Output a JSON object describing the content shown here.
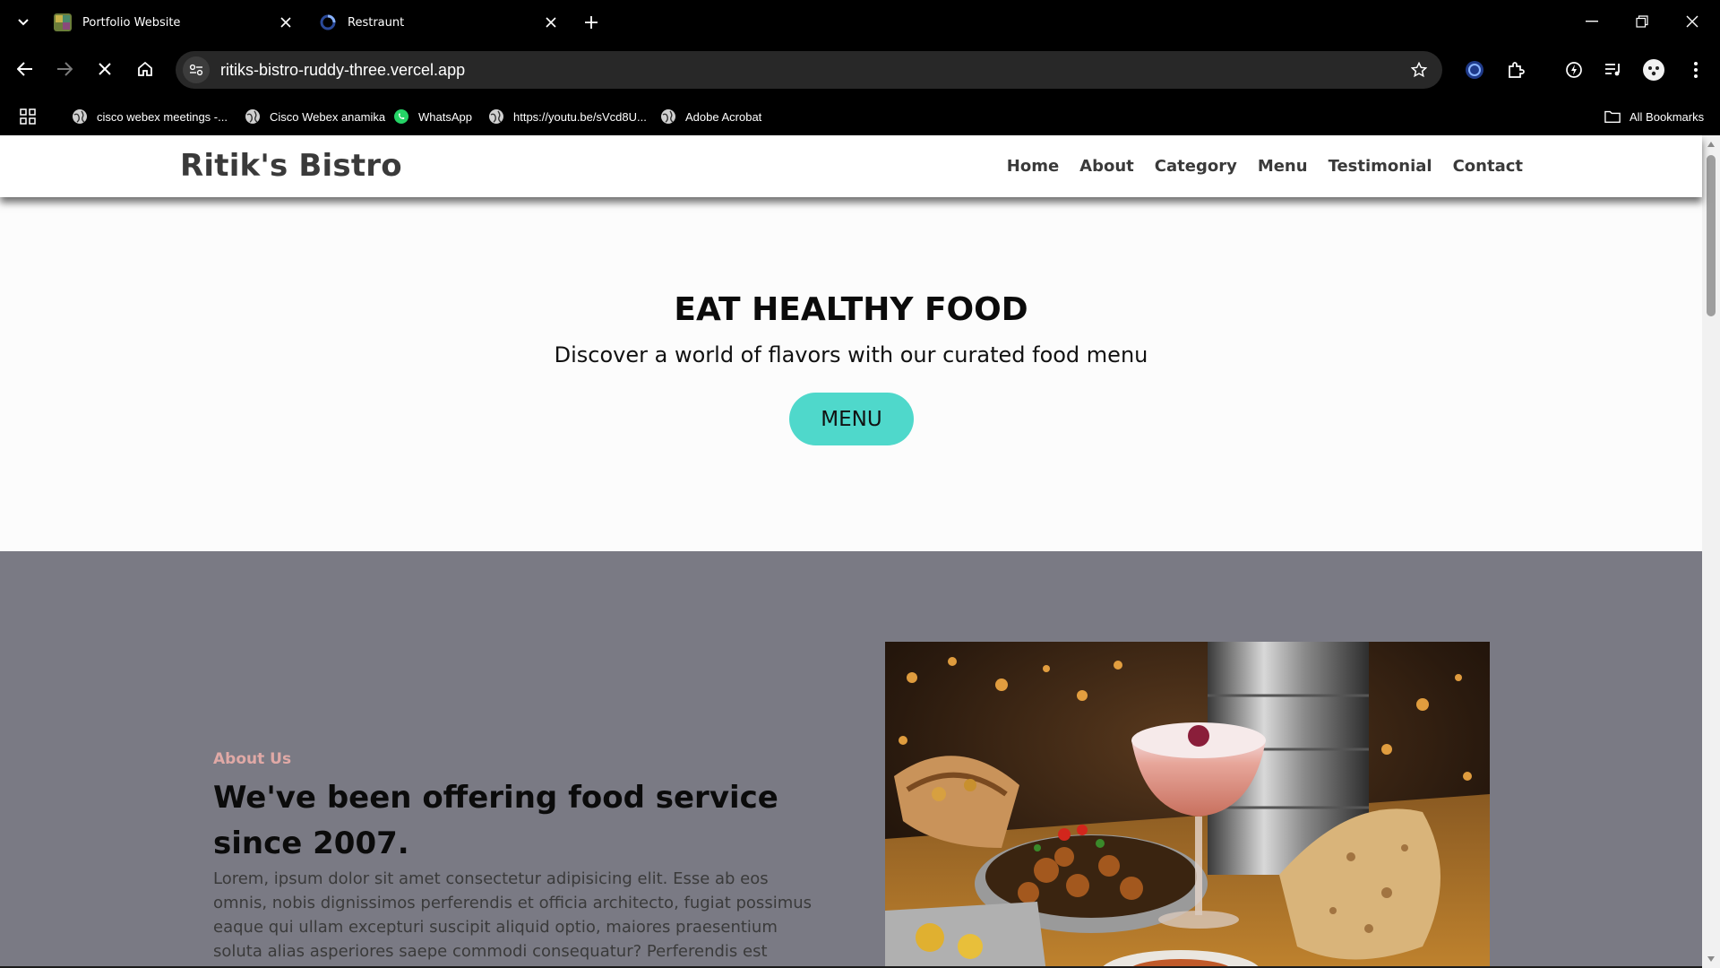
{
  "browser": {
    "tabs": [
      {
        "title": "Portfolio Website",
        "active": false
      },
      {
        "title": "Restraunt",
        "active": true
      }
    ],
    "url": "ritiks-bistro-ruddy-three.vercel.app",
    "bookmarks": [
      {
        "label": "cisco webex meetings -...",
        "icon": "globe-icon"
      },
      {
        "label": "Cisco Webex anamika",
        "icon": "globe-icon"
      },
      {
        "label": "WhatsApp",
        "icon": "whatsapp-icon"
      },
      {
        "label": "https://youtu.be/sVcd8U...",
        "icon": "globe-icon"
      },
      {
        "label": "Adobe Acrobat",
        "icon": "globe-icon"
      }
    ],
    "all_bookmarks": "All Bookmarks"
  },
  "site": {
    "brand": "Ritik's Bistro",
    "nav": [
      "Home",
      "About",
      "Category",
      "Menu",
      "Testimonial",
      "Contact"
    ],
    "hero": {
      "title": "EAT HEALTHY FOOD",
      "subtitle": "Discover a world of flavors with our curated food menu",
      "button": "MENU"
    },
    "about": {
      "tag": "About Us",
      "title": "We've been offering food service since 2007.",
      "text": "Lorem, ipsum dolor sit amet consectetur adipisicing elit. Esse ab eos omnis, nobis dignissimos perferendis et officia architecto, fugiat possimus eaque qui ullam excepturi suscipit aliquid optio, maiores praesentium soluta alias asperiores saepe commodi consequatur? Perferendis est placeat facere"
    }
  },
  "colors": {
    "accent": "#4fd8cb",
    "about_bg": "#7a7a84",
    "about_tag": "#e0a9a6"
  }
}
